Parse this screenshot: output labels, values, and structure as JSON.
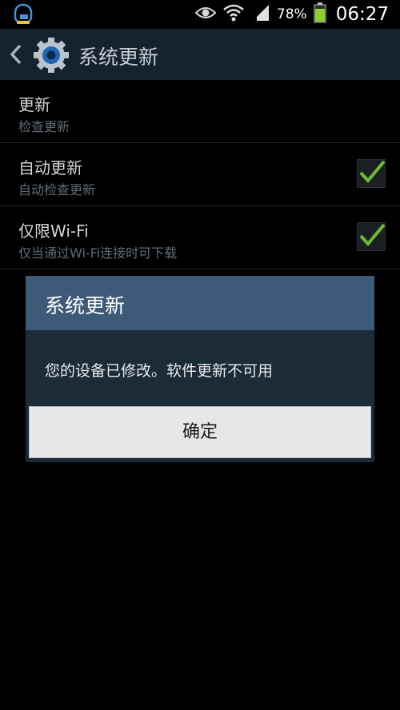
{
  "statusbar": {
    "battery_percent": "78%",
    "time": "06:27",
    "icons": [
      "chat-notification-icon",
      "eye-icon",
      "wifi-icon",
      "signal-icon",
      "battery-icon"
    ]
  },
  "actionbar": {
    "title": "系统更新",
    "icons": [
      "back-icon",
      "settings-gear-icon"
    ]
  },
  "list": {
    "items": [
      {
        "title": "更新",
        "subtitle": "检查更新",
        "checked": null
      },
      {
        "title": "自动更新",
        "subtitle": "自动检查更新",
        "checked": true
      },
      {
        "title": "仅限Wi-Fi",
        "subtitle": "仅当通过Wi-Fi连接时可下载",
        "checked": true
      }
    ]
  },
  "dialog": {
    "title": "系统更新",
    "message": "您的设备已修改。软件更新不可用",
    "ok_label": "确定"
  },
  "colors": {
    "actionbar_bg": "#152331",
    "dialog_header_bg": "#3d5b79",
    "dialog_body_bg": "#1b2b38",
    "check_green": "#6fbb2e",
    "battery_green": "#8fd12a"
  }
}
